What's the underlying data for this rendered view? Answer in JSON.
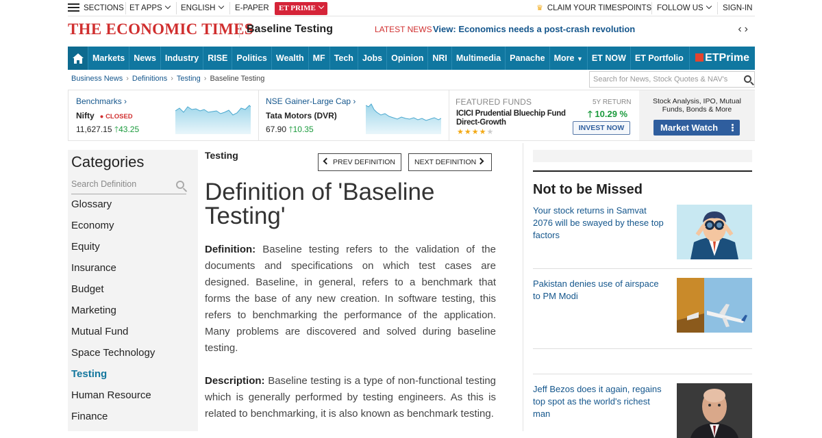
{
  "topbar": {
    "sections": "SECTIONS",
    "et_apps": "ET APPS",
    "english": "ENGLISH",
    "epaper": "E-PAPER",
    "et_prime": "ET PRIME",
    "claim": "CLAIM YOUR TIMESPOINTS",
    "follow": "FOLLOW US",
    "signin": "SIGN-IN"
  },
  "masthead": {
    "logo": "THE ECONOMIC TIMES",
    "title": "Baseline Testing",
    "latest_label": "LATEST NEWS",
    "latest_headline": "View: Economics needs a post-crash revolution",
    "arrows": "‹›"
  },
  "nav": {
    "items": [
      "Markets",
      "News",
      "Industry",
      "RISE",
      "Politics",
      "Wealth",
      "MF",
      "Tech",
      "Jobs",
      "Opinion",
      "NRI",
      "Multimedia",
      "Panache",
      "More",
      "ET NOW",
      "ET Portfolio"
    ],
    "prime": "ETPrime"
  },
  "breadcrumb": {
    "items": [
      "Business News",
      "Definitions",
      "Testing"
    ],
    "current": "Baseline Testing",
    "separator": "›"
  },
  "header_search": {
    "placeholder": "Search for News, Stock Quotes & NAV's"
  },
  "market": {
    "benchmarks": {
      "label": "Benchmarks",
      "name": "Nifty",
      "status": "CLOSED",
      "value": "11,627.15",
      "change": "43.25"
    },
    "gainer": {
      "label": "NSE Gainer-Large Cap",
      "name": "Tata Motors (DVR)",
      "value": "67.90",
      "change": "10.35"
    },
    "featured": {
      "label": "FEATURED FUNDS",
      "return_label": "5Y RETURN",
      "return_value": "10.29 %",
      "fund_name": "ICICI Prudential Bluechip Fund Direct-Growth",
      "rating": 4,
      "rating_max": 5,
      "invest": "INVEST NOW"
    },
    "watch": {
      "text": "Stock Analysis, IPO, Mutual Funds, Bonds & More",
      "button": "Market Watch"
    }
  },
  "categories": {
    "title": "Categories",
    "search_placeholder": "Search Definition",
    "items": [
      "Glossary",
      "Economy",
      "Equity",
      "Insurance",
      "Budget",
      "Marketing",
      "Mutual Fund",
      "Space Technology",
      "Testing",
      "Human Resource",
      "Finance"
    ],
    "active": "Testing"
  },
  "article": {
    "category": "Testing",
    "prev": "PREV DEFINITION",
    "next": "NEXT DEFINITION",
    "title": "Definition of 'Baseline Testing'",
    "definition_label": "Definition:",
    "definition": "Baseline testing refers to the validation of the documents and specifications on which test cases are designed. Baseline, in general, refers to a benchmark that forms the base of any new creation. In software testing, this refers to benchmarking the performance of the application. Many problems are discovered and solved during baseline testing.",
    "description_label": "Description:",
    "description": "Baseline testing is a type of non-functional testing which is generally performed by testing engineers. As this is related to benchmarking, it is also known as benchmark testing."
  },
  "sidebar_right": {
    "title": "Not to be Missed",
    "stories": [
      {
        "headline": "Your stock returns in Samvat 2076 will be swayed by these top factors"
      },
      {
        "headline": "Pakistan denies use of airspace to PM Modi"
      },
      {
        "headline": "Jeff Bezos does it again, regains top spot as the world's richest man"
      }
    ]
  },
  "colors": {
    "nav_bg": "#1077a0",
    "logo_red": "#d02f2f",
    "link_blue": "#14568c",
    "gain_green": "#1a9a3c",
    "market_watch_bg": "#2f5e9e"
  }
}
